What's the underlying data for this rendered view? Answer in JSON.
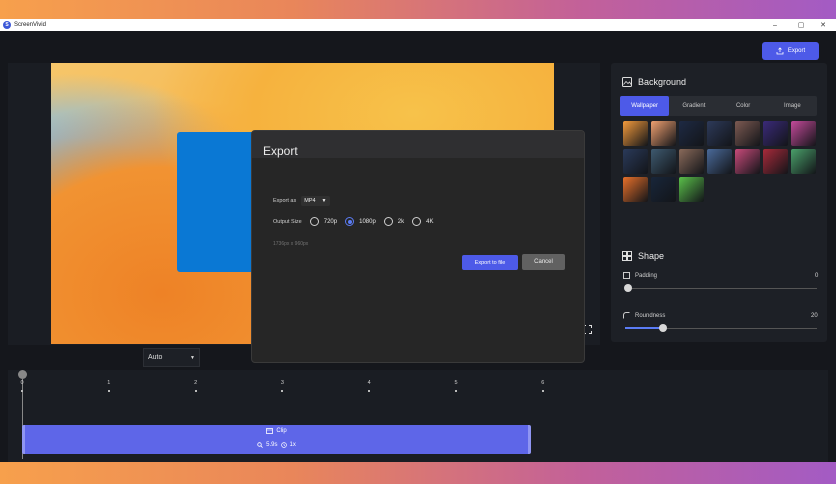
{
  "app": {
    "title": "ScreenVivid",
    "logo_letter": "S"
  },
  "window_controls": {
    "minimize": "–",
    "maximize": "▢",
    "close": "✕"
  },
  "toolbar": {
    "export_label": "Export"
  },
  "export_dialog": {
    "title": "Export",
    "export_as_label": "Export as",
    "format_value": "MP4",
    "output_size_label": "Output Size",
    "sizes": [
      "720p",
      "1080p",
      "2k",
      "4K"
    ],
    "selected_size": "1080p",
    "resolution_text": "1736px x 960px",
    "export_button": "Export to file",
    "cancel_button": "Cancel"
  },
  "aspect_dropdown": {
    "value": "Auto"
  },
  "background_panel": {
    "title": "Background",
    "tabs": [
      "Wallpaper",
      "Gradient",
      "Color",
      "Image"
    ],
    "active_tab": "Wallpaper",
    "wallpapers": [
      "#f39a3c",
      "#f0a070",
      "#1e2a44",
      "#2d3a5a",
      "#7d5a52",
      "#3a2a7a",
      "#c44a9a",
      "#2a3a5a",
      "#3e5a70",
      "#8a6a5a",
      "#4a6a9a",
      "#c84a7a",
      "#a82a3a",
      "#4aa06a",
      "#e8702a",
      "#18263a",
      "#5ac04a"
    ]
  },
  "shape_panel": {
    "title": "Shape",
    "padding_label": "Padding",
    "padding_value": "0",
    "padding_level": 0,
    "roundness_label": "Roundness",
    "roundness_value": "20",
    "roundness_level": 0.2
  },
  "timeline": {
    "ticks": [
      "0",
      "1",
      "2",
      "3",
      "4",
      "5",
      "6"
    ],
    "clip_label": "Clip",
    "clip_duration": "5.9s",
    "clip_speed": "1x"
  },
  "colors": {
    "accent": "#4d5ae8",
    "clip": "#5e66e8",
    "panel": "#1d2026"
  }
}
